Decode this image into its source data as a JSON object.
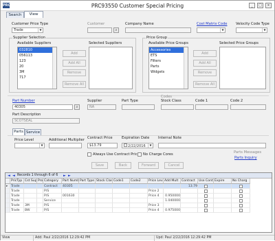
{
  "window": {
    "title": "PRC93550 Customer Special Pricing",
    "app_icon": "PRC",
    "min": "_",
    "max": "□",
    "close": "×"
  },
  "tabs": [
    "Search",
    "View"
  ],
  "header": {
    "customer_price_type_label": "Customer Price Type",
    "customer_price_type_value": "Trade",
    "customer_label": "Customer",
    "company_name_label": "Company Name",
    "cost_matrix_code_label": "Cost Matrix Code",
    "velocity_code_type_label": "Velocity Code Type"
  },
  "supplier_selection": {
    "title": "Supplier Selection",
    "available_label": "Available Suppliers",
    "selected_label": "Selected Suppliers",
    "available": [
      "032810",
      "056113",
      "123",
      "20",
      "3M",
      "717"
    ],
    "selected_index": 0,
    "buttons": {
      "add": "Add",
      "add_all": "Add All",
      "remove": "Remove",
      "remove_all": "Remove All"
    }
  },
  "price_group": {
    "title": "Price Group",
    "available_label": "Available Price Groups",
    "selected_label": "Selected Price Groups",
    "available": [
      "Accessories",
      "ETS",
      "Filters",
      "Parts",
      "Widgets"
    ],
    "selected_index": 0,
    "buttons": {
      "add": "Add",
      "add_all": "Add All",
      "remove": "Remove",
      "remove_all": "Remove All"
    }
  },
  "part": {
    "part_number_label": "Part Number",
    "part_number_value": "40305",
    "supplier_label": "Supplier",
    "supplier_value": "NA",
    "part_type_label": "Part Type",
    "codes_label": "Codes",
    "stock_class_label": "Stock Class",
    "code1_label": "Code 1",
    "code2_label": "Code 2",
    "description_label": "Part Description",
    "description_value": "SCOTSEAL"
  },
  "detail_tabs": [
    "Parts",
    "Service"
  ],
  "pricing": {
    "price_level_label": "Price Level",
    "additional_multiplier_label": "Additional Multiplier",
    "contract_price_label": "Contract Price",
    "contract_price_value": "$13.79",
    "expiration_date_label": "Expiration Date",
    "expiration_date_value": "2/22/2016",
    "internal_note_label": "Internal Note",
    "always_use_contract_label": "Always Use Contract Price",
    "no_charge_cores_label": "No Charge Cores",
    "parts_messages_label": "Parts Messages",
    "parts_inquiry_label": "Parts Inquiry"
  },
  "actions": {
    "save": "Save",
    "back": "Back",
    "forward": "Forward",
    "cancel": "Cancel"
  },
  "grid": {
    "record_bar": "Records 1 through 6 of 6",
    "columns": [
      "PricTyp",
      "Cst Supp",
      "Prod",
      "Category",
      "Part Numb",
      "Part Type",
      "Stock Clas",
      "Code1",
      "Code2",
      "Price Level",
      "Add Mult",
      "Contract",
      "Use Contr",
      "Expire",
      "No Charg"
    ],
    "rows": [
      [
        "Trade",
        "",
        "",
        "Contract",
        "40305",
        "",
        "",
        "",
        "",
        "",
        "",
        "13.79",
        "",
        "",
        ""
      ],
      [
        "Trade",
        "",
        "",
        "P/S",
        "",
        "",
        "",
        "",
        "",
        "Price 2",
        "",
        "",
        "",
        "",
        ""
      ],
      [
        "Trade",
        "",
        "",
        "P/S",
        "001630",
        "",
        "",
        "",
        "",
        "Price 4",
        "0.950000",
        "",
        "",
        "",
        ""
      ],
      [
        "Trade",
        "",
        "",
        "Service",
        "",
        "",
        "",
        "",
        "",
        "",
        "1.040000",
        "",
        "",
        "",
        ""
      ],
      [
        "Trade",
        "3M",
        "",
        "P/S",
        "",
        "",
        "",
        "",
        "",
        "Price 3",
        "",
        "",
        "",
        "",
        ""
      ],
      [
        "Trade",
        "BW",
        "",
        "P/S",
        "",
        "",
        "",
        "",
        "",
        "Price 4",
        "0.975000",
        "",
        "",
        "",
        ""
      ]
    ],
    "checkbox_columns": [
      12,
      14
    ]
  },
  "status": {
    "mode": "View",
    "added": "Add: Paul 2/22/2016 12:29:42 PM",
    "updated": "Upd: Paul 2/22/2016 12:29:42 PM"
  }
}
